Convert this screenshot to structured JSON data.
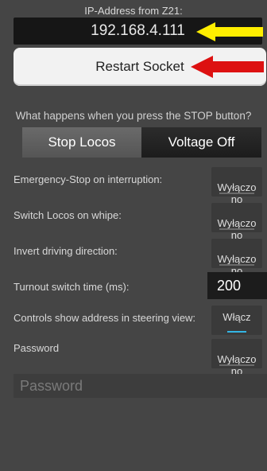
{
  "connection": {
    "ip_caption": "IP-Address from Z21:",
    "ip_value": "192.168.4.111",
    "restart_label": "Restart Socket"
  },
  "stop_section": {
    "question": "What happens when you press the STOP button?",
    "options": [
      "Stop Locos",
      "Voltage Off"
    ],
    "selected": "Voltage Off"
  },
  "settings": [
    {
      "label": "Emergency-Stop on interruption:",
      "toggle": "Wyłączo\nno",
      "on": false
    },
    {
      "label": "Switch Locos on whipe:",
      "toggle": "Wyłączo\nno",
      "on": false
    },
    {
      "label": "Invert driving direction:",
      "toggle": "Wyłączo\nno",
      "on": false
    }
  ],
  "turnout": {
    "label": "Turnout switch time (ms):",
    "value": "200"
  },
  "controls_address": {
    "label": "Controls show address in steering view:",
    "toggle": "Włącz",
    "on": true
  },
  "password": {
    "label": "Password",
    "toggle": "Wyłączo\nno",
    "on": false,
    "placeholder": "Password"
  },
  "colors": {
    "yellow_arrow": "#ffee00",
    "red_arrow": "#dd1111",
    "toggle_on_accent": "#33b5e5"
  }
}
